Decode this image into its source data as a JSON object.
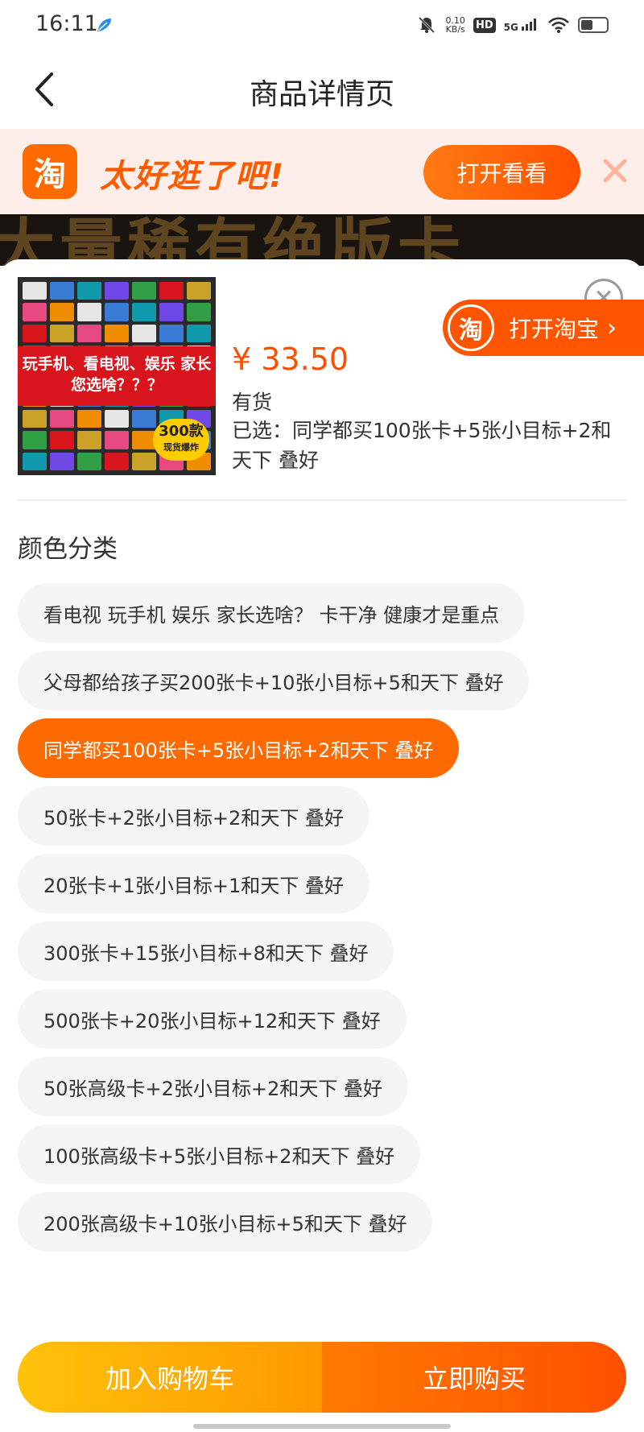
{
  "status_bar": {
    "time": "16:11",
    "speed_value": "0.10",
    "speed_unit": "KB/s",
    "hd": "HD",
    "network": "5G"
  },
  "header": {
    "title": "商品详情页"
  },
  "banner": {
    "logo_char": "淘",
    "slogan": "太好逛了吧!",
    "open_button": "打开看看"
  },
  "background_text": "大量稀有绝版卡",
  "product": {
    "image_caption": "玩手机、看电视、娱乐 家长您选啥？？？",
    "badge_main": "300款",
    "badge_sub": "现货爆炸",
    "price": "¥ 33.50",
    "stock": "有货",
    "selected": "已选：同学都买100张卡+5张小目标+2和天下 叠好"
  },
  "open_taobao": {
    "icon_char": "淘",
    "label": "打开淘宝",
    "chevron": "›"
  },
  "section": {
    "title": "颜色分类"
  },
  "options": [
    {
      "label": "看电视 玩手机 娱乐 家长选啥？ 卡干净 健康才是重点",
      "selected": false
    },
    {
      "label": "父母都给孩子买200张卡+10张小目标+5和天下 叠好",
      "selected": false
    },
    {
      "label": "同学都买100张卡+5张小目标+2和天下 叠好",
      "selected": true
    },
    {
      "label": "50张卡+2张小目标+2和天下 叠好",
      "selected": false
    },
    {
      "label": "20张卡+1张小目标+1和天下 叠好",
      "selected": false
    },
    {
      "label": "300张卡+15张小目标+8和天下 叠好",
      "selected": false
    },
    {
      "label": "500张卡+20张小目标+12和天下 叠好",
      "selected": false
    },
    {
      "label": "50张高级卡+2张小目标+2和天下 叠好",
      "selected": false
    },
    {
      "label": "100张高级卡+5张小目标+2和天下 叠好",
      "selected": false
    },
    {
      "label": "200张高级卡+10张小目标+5和天下 叠好",
      "selected": false
    }
  ],
  "bottom_bar": {
    "add_to_cart": "加入购物车",
    "buy_now": "立即购买"
  },
  "colors": {
    "accent": "#ff5000",
    "cart": "#ffb400",
    "chip_bg": "#f5f5f5"
  }
}
